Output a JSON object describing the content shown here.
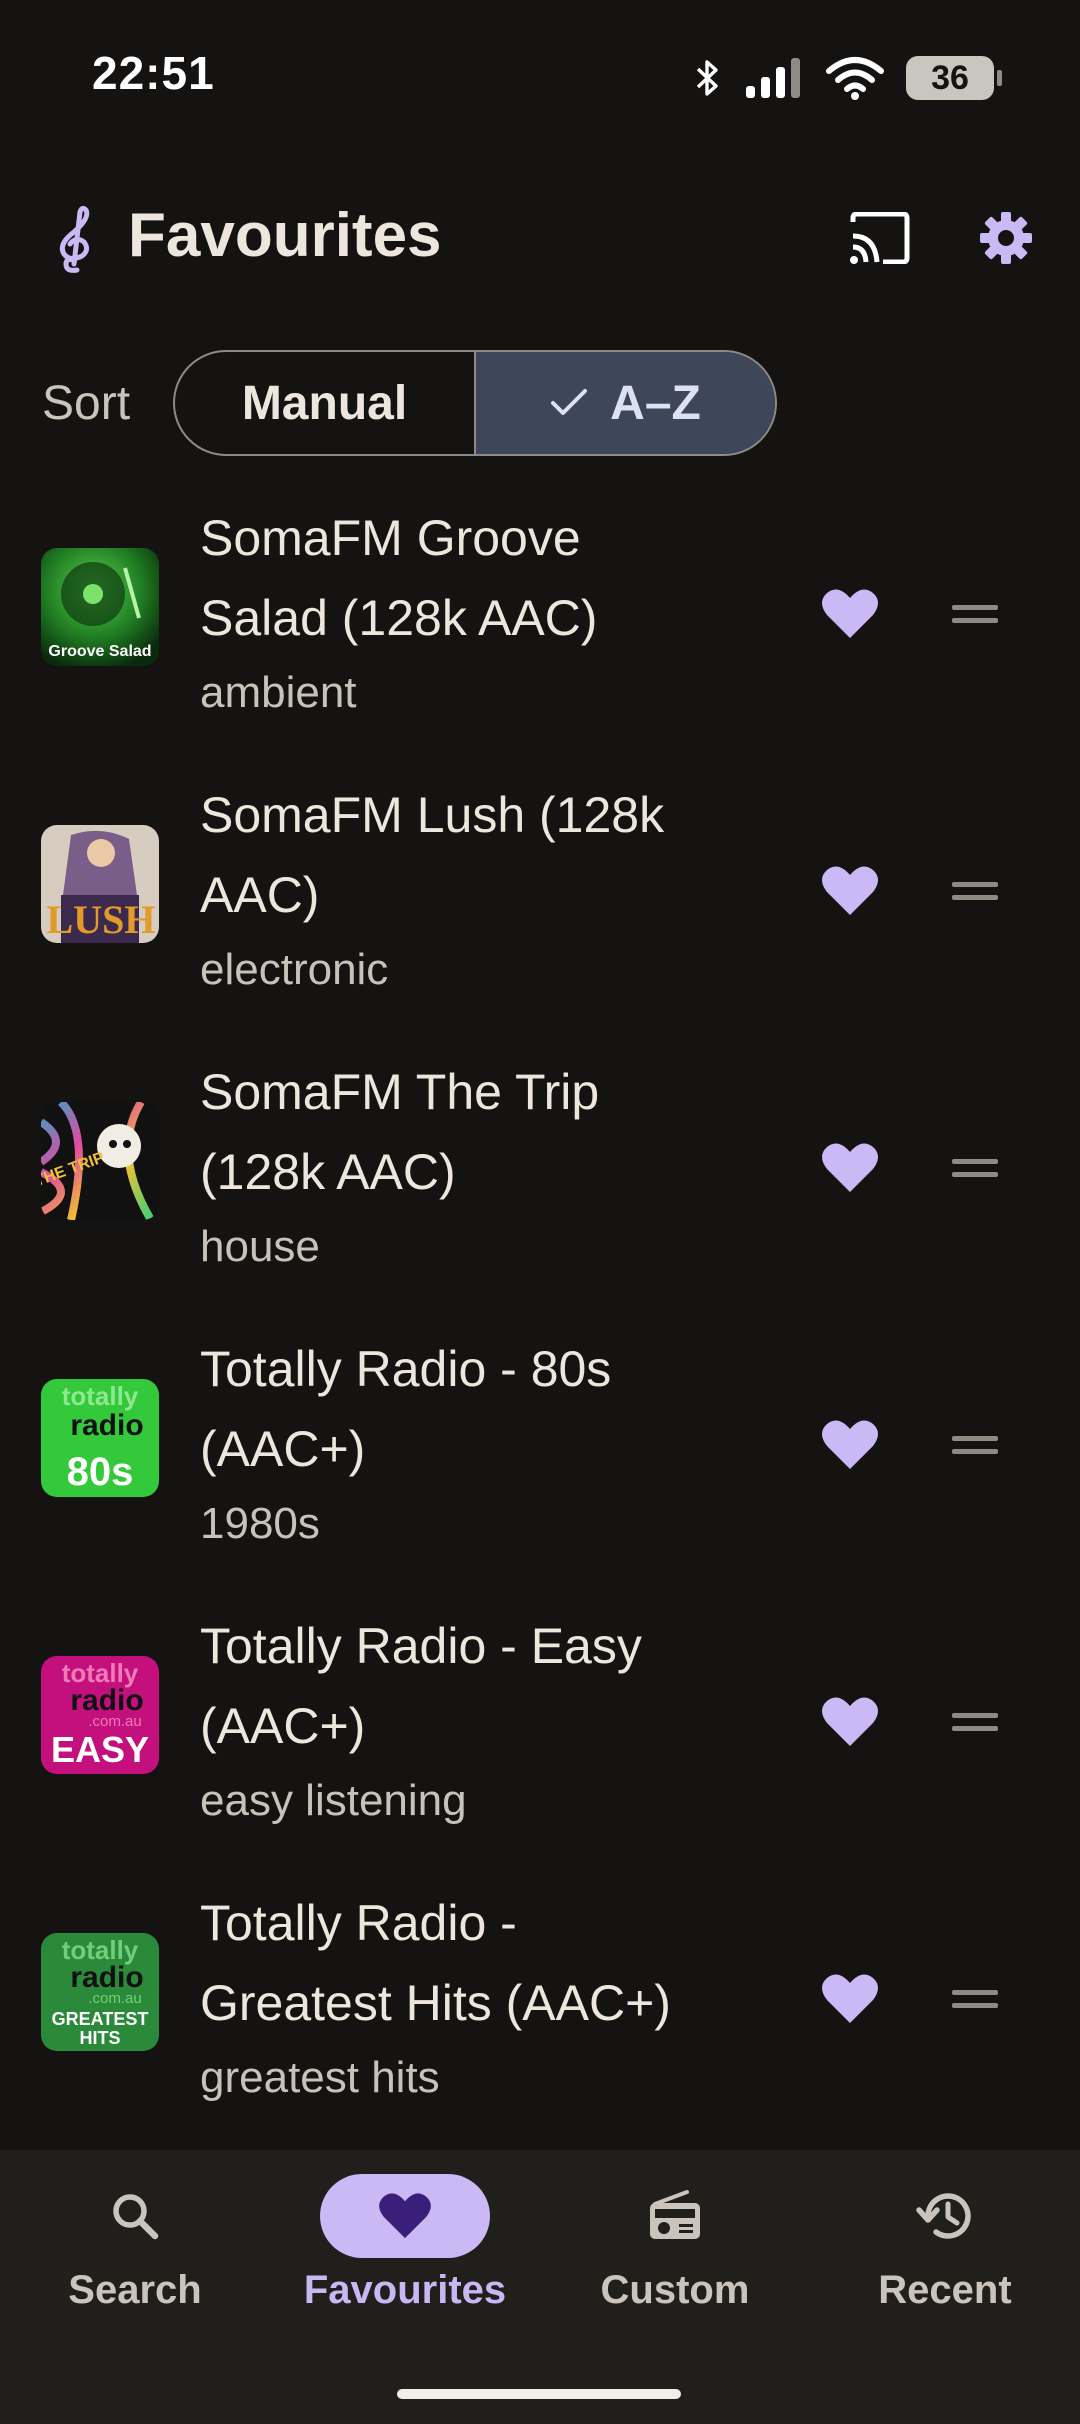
{
  "status_bar": {
    "time": "22:51",
    "battery_level": "36",
    "icons": [
      "bluetooth-icon",
      "signal-icon",
      "wifi-icon",
      "battery-icon"
    ]
  },
  "header": {
    "title": "Favourites",
    "logo_icon": "treble-clef-icon",
    "actions": [
      "cast-icon",
      "gear-icon"
    ]
  },
  "sort": {
    "label": "Sort",
    "options": [
      {
        "label": "Manual",
        "selected": false
      },
      {
        "label": "A–Z",
        "selected": true
      }
    ]
  },
  "stations": [
    {
      "name_line1": "SomaFM Groove",
      "name_line2": "Salad (128k AAC)",
      "genre": "ambient",
      "art_text": "Groove Salad",
      "favourite": true
    },
    {
      "name_line1": "SomaFM Lush (128k",
      "name_line2": "AAC)",
      "genre": "electronic",
      "art_text": "LUSH",
      "favourite": true
    },
    {
      "name_line1": "SomaFM The Trip",
      "name_line2": "(128k AAC)",
      "genre": "house",
      "art_text": "THE TRIP",
      "favourite": true
    },
    {
      "name_line1": "Totally Radio - 80s",
      "name_line2": "(AAC+)",
      "genre": "1980s",
      "art_text_top": "totally",
      "art_text_mid": "radio",
      "art_text_bottom": "80s",
      "favourite": true
    },
    {
      "name_line1": "Totally Radio - Easy",
      "name_line2": "(AAC+)",
      "genre": "easy listening",
      "art_text_top": "totally",
      "art_text_mid": "radio",
      "art_text_sub": ".com.au",
      "art_text_bottom": "EASY",
      "favourite": true
    },
    {
      "name_line1": "Totally Radio -",
      "name_line2": "Greatest Hits (AAC+)",
      "genre": "greatest hits",
      "art_text_top": "totally",
      "art_text_mid": "radio",
      "art_text_sub": ".com.au",
      "art_text_bottom": "GREATEST",
      "art_text_bottom2": "HITS",
      "favourite": true
    }
  ],
  "bottom_nav": [
    {
      "label": "Search",
      "icon": "search-icon",
      "active": false
    },
    {
      "label": "Favourites",
      "icon": "heart-icon",
      "active": true
    },
    {
      "label": "Custom",
      "icon": "radio-icon",
      "active": false
    },
    {
      "label": "Recent",
      "icon": "history-icon",
      "active": false
    }
  ],
  "colors": {
    "background": "#141311",
    "accent": "#cbb9f5",
    "nav_background": "#201f1c",
    "segment_selected": "#3e4659"
  }
}
